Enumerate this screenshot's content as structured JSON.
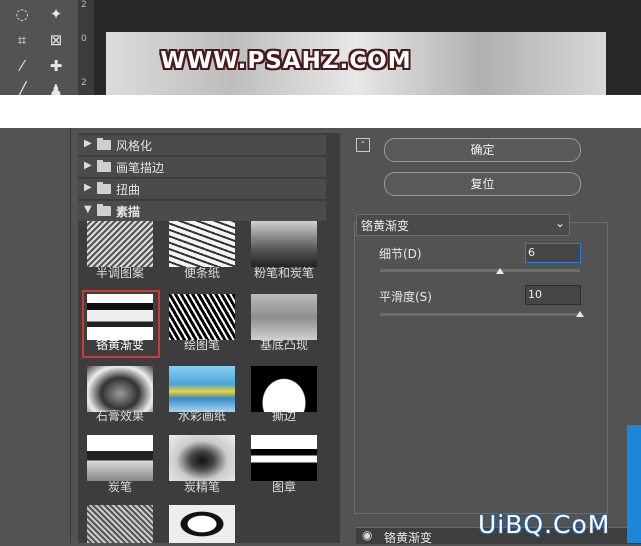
{
  "app": {
    "ruler_marks": [
      "2",
      "0",
      "2"
    ],
    "canvas_text": "WWW.PSAHZ.COM"
  },
  "gallery": {
    "categories": [
      {
        "label": "风格化",
        "state": "collapsed"
      },
      {
        "label": "画笔描边",
        "state": "collapsed"
      },
      {
        "label": "扭曲",
        "state": "collapsed"
      },
      {
        "label": "素描",
        "state": "expanded"
      }
    ],
    "thumbnails": [
      {
        "label": "半调图案"
      },
      {
        "label": "便条纸"
      },
      {
        "label": "粉笔和炭笔"
      },
      {
        "label": "铬黄渐变",
        "selected": true
      },
      {
        "label": "绘图笔"
      },
      {
        "label": "基底凸现"
      },
      {
        "label": "石膏效果"
      },
      {
        "label": "水彩画纸"
      },
      {
        "label": "撕边"
      },
      {
        "label": "炭笔"
      },
      {
        "label": "炭精笔"
      },
      {
        "label": "图章"
      }
    ]
  },
  "panel": {
    "ok_label": "确定",
    "reset_label": "复位",
    "filter_select_value": "铬黄渐变",
    "params": [
      {
        "label": "细节(D)",
        "value": "6",
        "slider_fraction": 0.6
      },
      {
        "label": "平滑度(S)",
        "value": "10",
        "slider_fraction": 1.0
      }
    ],
    "layer_row_label": "铬黄渐变"
  },
  "watermark": "UiBQ.CoM",
  "colors": {
    "selection_border": "#c93a3a",
    "focus_border": "#2d7bd8",
    "accent_blue": "#1d86d8"
  }
}
